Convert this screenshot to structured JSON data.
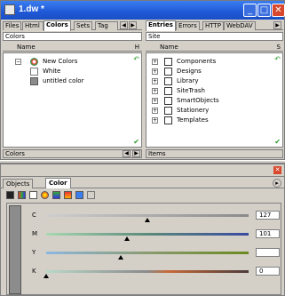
{
  "window": {
    "title": "1.dw *",
    "controls": {
      "minimize": "_",
      "maximize": "□",
      "close": "✕"
    }
  },
  "left_pane": {
    "tabs": [
      "Files",
      "Html",
      "Colors",
      "Sets",
      "Tag"
    ],
    "path": "Colors",
    "columns": {
      "name": "Name",
      "last": "H"
    },
    "rows": [
      {
        "label": "New Colors",
        "expander": "−",
        "icon": "color-folder-icon"
      },
      {
        "label": "White",
        "icon": "white-swatch-icon"
      },
      {
        "label": "untitled color",
        "icon": "gray-swatch-icon"
      }
    ],
    "status": "Colors"
  },
  "right_pane": {
    "tabs": [
      "Entries",
      "Errors",
      "HTTP",
      "WebDAV"
    ],
    "path": "Site",
    "columns": {
      "name": "Name",
      "last": "S"
    },
    "rows": [
      {
        "label": "Components",
        "expander": "+"
      },
      {
        "label": "Designs",
        "expander": "+"
      },
      {
        "label": "Library",
        "expander": "+"
      },
      {
        "label": "SiteTrash",
        "expander": "+"
      },
      {
        "label": "SmartObjects",
        "expander": "+"
      },
      {
        "label": "Stationery",
        "expander": "+"
      },
      {
        "label": "Templates",
        "expander": "+"
      }
    ],
    "status": "Items"
  },
  "color_panel": {
    "tabs": [
      "Objects",
      "Color"
    ],
    "sliders": [
      {
        "label": "C",
        "value": "127",
        "fraction": 0.5
      },
      {
        "label": "M",
        "value": "101",
        "fraction": 0.4
      },
      {
        "label": "Y",
        "value": "",
        "fraction": 0.37
      },
      {
        "label": "K",
        "value": "0",
        "fraction": 0.0
      }
    ],
    "swatch_color": "#8c8c8c"
  },
  "colors": {
    "titlebar": "#1f58d6",
    "close": "#d8482c",
    "check_green": "#2c9a2c"
  }
}
